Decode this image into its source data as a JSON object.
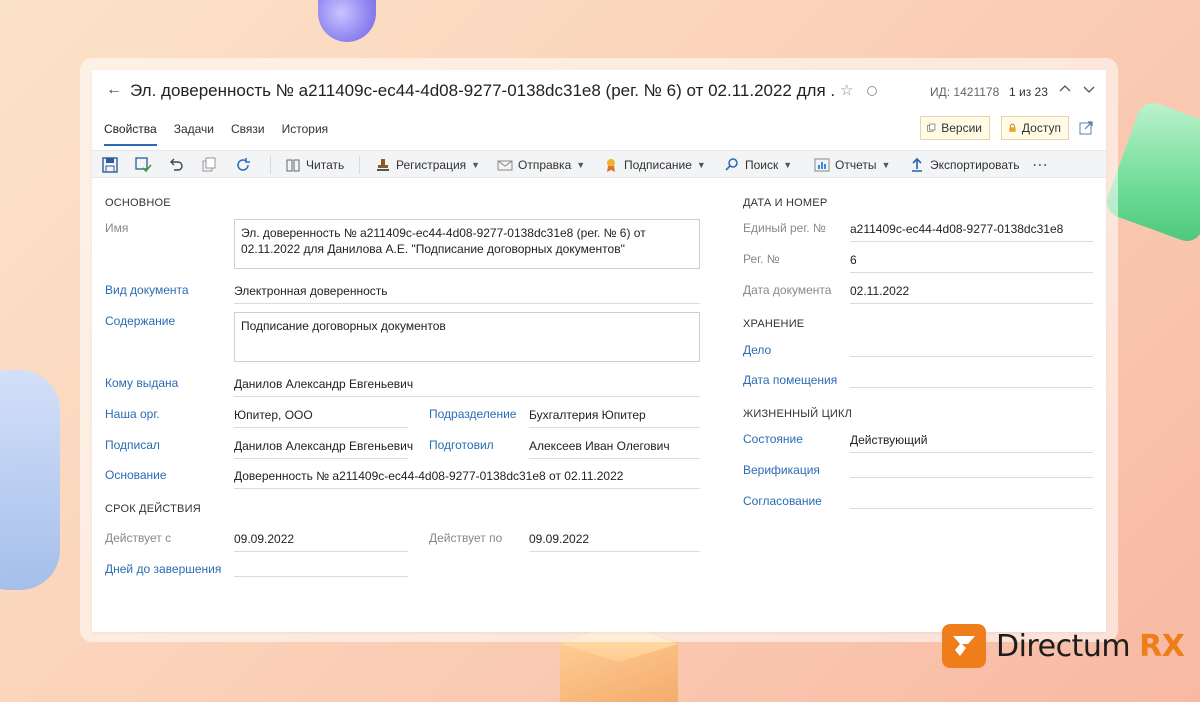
{
  "header": {
    "title": "Эл. доверенность № a211409c-ec44-4d08-9277-0138dc31e8 (рег. № 6) от 02.11.2022 для ...",
    "id_label": "ИД: 1421178",
    "pager": "1 из 23"
  },
  "tabs": [
    {
      "label": "Свойства",
      "active": true
    },
    {
      "label": "Задачи"
    },
    {
      "label": "Связи"
    },
    {
      "label": "История"
    }
  ],
  "actions": {
    "versions": "Версии",
    "access": "Доступ"
  },
  "toolbar": {
    "read": "Читать",
    "registration": "Регистрация",
    "send": "Отправка",
    "sign": "Подписание",
    "search": "Поиск",
    "reports": "Отчеты",
    "export": "Экспортировать",
    "more": "⋯"
  },
  "left": {
    "section_main": "ОСНОВНОЕ",
    "name_label": "Имя",
    "name_value": "Эл. доверенность № a211409c-ec44-4d08-9277-0138dc31e8 (рег. № 6) от 02.11.2022 для Данилова А.Е. \"Подписание договорных документов\"",
    "doctype_label": "Вид документа",
    "doctype_value": "Электронная доверенность",
    "content_label": "Содержание",
    "content_value": "Подписание договорных документов",
    "issued_to_label": "Кому выдана",
    "issued_to_value": "Данилов Александр Евгеньевич",
    "org_label": "Наша орг.",
    "org_value": "Юпитер, ООО",
    "dept_label": "Подразделение",
    "dept_value": "Бухгалтерия Юпитер",
    "signed_label": "Подписал",
    "signed_value": "Данилов Александр Евгеньевич",
    "prepared_label": "Подготовил",
    "prepared_value": "Алексеев Иван Олегович",
    "basis_label": "Основание",
    "basis_value": "Доверенность № a211409c-ec44-4d08-9277-0138dc31e8 от 02.11.2022",
    "section_validity": "СРОК ДЕЙСТВИЯ",
    "valid_from_label": "Действует с",
    "valid_from_value": "09.09.2022",
    "valid_to_label": "Действует по",
    "valid_to_value": "09.09.2022",
    "days_left_label": "Дней до завершения",
    "days_left_value": ""
  },
  "right": {
    "section_date": "ДАТА И НОМЕР",
    "reg_no_label": "Единый рег. №",
    "reg_no_value": "a211409c-ec44-4d08-9277-0138dc31e8",
    "reg_label": "Рег. №",
    "reg_value": "6",
    "doc_date_label": "Дата документа",
    "doc_date_value": "02.11.2022",
    "section_storage": "ХРАНЕНИЕ",
    "case_label": "Дело",
    "case_value": "",
    "placement_label": "Дата помещения",
    "placement_value": "",
    "section_lifecycle": "ЖИЗНЕННЫЙ ЦИКЛ",
    "state_label": "Состояние",
    "state_value": "Действующий",
    "verify_label": "Верификация",
    "verify_value": "",
    "approval_label": "Согласование",
    "approval_value": ""
  },
  "logo": {
    "name": "Directum",
    "suffix": "RX"
  },
  "colors": {
    "accent": "#2a6bb5",
    "brand": "#ef7d1a"
  }
}
